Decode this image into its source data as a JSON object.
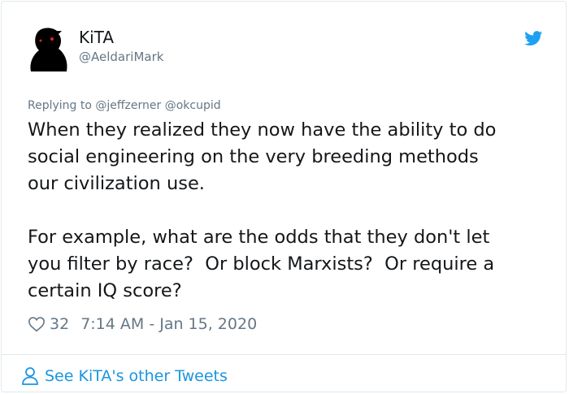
{
  "author": {
    "display_name": "KiTA",
    "handle": "@AeldariMark"
  },
  "replying": {
    "prefix": "Replying to",
    "mentions": [
      "@jeffzerner",
      "@okcupid"
    ]
  },
  "tweet": {
    "text": "When they realized they now have the ability to do\nsocial engineering on the very breeding methods\nour civilization use.\n\nFor example, what are the odds that they don't let\nyou filter by race?  Or block Marxists?  Or require a\ncertain IQ score?"
  },
  "meta": {
    "likes": "32",
    "timestamp": "7:14 AM - Jan 15, 2020"
  },
  "footer": {
    "link_label": "See KiTA's other Tweets"
  },
  "icons": {
    "brand": "twitter-bird-icon",
    "like": "heart-icon",
    "profile": "person-icon"
  },
  "colors": {
    "accent": "#1da1f2",
    "link": "#1b95e0",
    "secondary_text": "#657786",
    "border": "#e1e8ed"
  }
}
